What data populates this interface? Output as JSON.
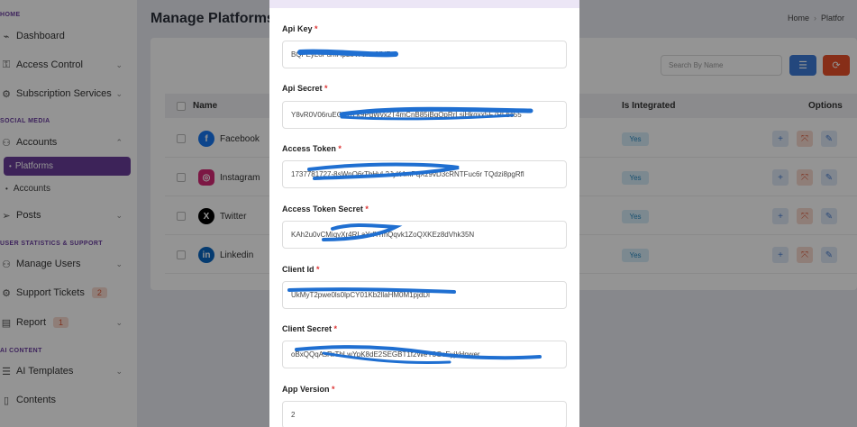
{
  "sidebar": {
    "sections": {
      "home": "HOME",
      "social": "SOCIAL MEDIA",
      "stats": "USER STATISTICS & SUPPORT",
      "ai": "AI CONTENT"
    },
    "items": {
      "dashboard": "Dashboard",
      "access_control": "Access Control",
      "subscription": "Subscription Services",
      "accounts": "Accounts",
      "platforms": "Platforms",
      "accounts_sub": "Accounts",
      "posts": "Posts",
      "manage_users": "Manage Users",
      "support_tickets": "Support Tickets",
      "support_count": "2",
      "report": "Report",
      "report_count": "1",
      "ai_templates": "AI Templates",
      "contents": "Contents"
    }
  },
  "page": {
    "title": "Manage Platforms",
    "breadcrumb_home": "Home",
    "breadcrumb_current": "Platfor"
  },
  "toolbar": {
    "search_placeholder": "Search By Name"
  },
  "table": {
    "headers": {
      "name": "Name",
      "integrated": "Is Integrated",
      "options": "Options"
    },
    "rows": [
      {
        "name": "Facebook",
        "integrated": "Yes"
      },
      {
        "name": "Instagram",
        "integrated": "Yes"
      },
      {
        "name": "Twitter",
        "integrated": "Yes"
      },
      {
        "name": "Linkedin",
        "integrated": "Yes"
      }
    ]
  },
  "modal": {
    "required_mark": "*",
    "fields": [
      {
        "label": "Api Key",
        "value": "BQFEyLoFumHpLtRT6wn6fNF"
      },
      {
        "label": "Api Secret",
        "value": "Y8vR0V06ruEGh7rLk9PqWvx2T4mCnB85iBqQpRrLsiHkgxx5F7PLbc55"
      },
      {
        "label": "Access Token",
        "value": "1737781727-8sWnQ6rTbHvL2JyK4mPqXz9vD3cRNTFuc6r TQdzi8pgRfl"
      },
      {
        "label": "Access Token Secret",
        "value": "KAh2u0vCMiqyXr4RLaYrfYrmQqvk1ZoQXKEz8dVhk35N"
      },
      {
        "label": "Client Id",
        "value": "UkMyT2pwe0ls0lpCY01Kb2llaHM0M1pjdDl"
      },
      {
        "label": "Client Secret",
        "value": "oBxQQqAsRrTbLwYpK8dE2SEGBT1f2WeY3GcEyjkHpwer"
      },
      {
        "label": "App Version",
        "value": "2"
      }
    ]
  },
  "colors": {
    "brand": "#6a3d9a",
    "scribble": "#1f6fd1",
    "danger": "#e8502a",
    "primary": "#3d7bd8"
  }
}
